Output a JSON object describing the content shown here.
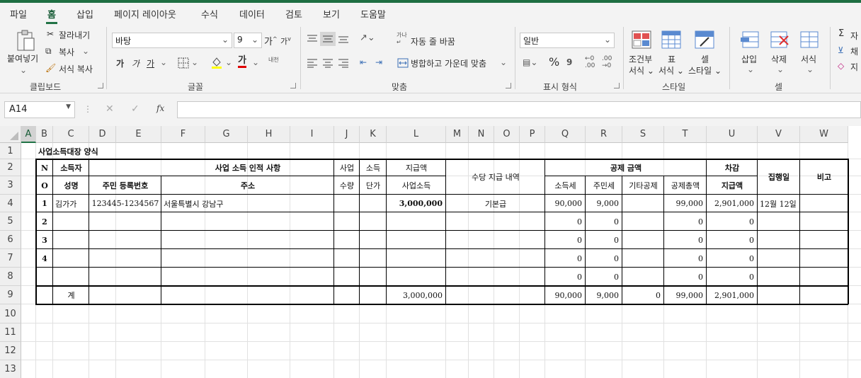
{
  "menu": [
    "파일",
    "홈",
    "삽입",
    "페이지 레이아웃",
    "수식",
    "데이터",
    "검토",
    "보기",
    "도움말"
  ],
  "clipboard": {
    "paste": "붙여넣기",
    "cut": "잘라내기",
    "copy": "복사",
    "format_painter": "서식 복사",
    "label": "클립보드"
  },
  "font": {
    "name": "바탕",
    "size": "9",
    "grow": "가",
    "shrink": "가",
    "bold": "가",
    "italic": "가",
    "underline": "가",
    "font_color": "가",
    "phonetic": "내천",
    "label": "글꼴"
  },
  "alignment": {
    "wrap": "자동 줄 바꿈",
    "merge": "병합하고 가운데 맞춤",
    "label": "맞춤"
  },
  "number": {
    "format": "일반",
    "percent": "%",
    "label": "표시 형식"
  },
  "styles": {
    "conditional_1": "조건부",
    "conditional_2": "서식",
    "table_1": "표",
    "table_2": "서식",
    "cell_1": "셀",
    "cell_2": "스타일",
    "label": "스타일"
  },
  "cells": {
    "insert": "삽입",
    "delete": "삭제",
    "format": "서식",
    "label": "셀"
  },
  "editing": {
    "sum": "자",
    "fill": "채",
    "clear": "지"
  },
  "formula_bar": {
    "name_box": "A14",
    "formula": "",
    "fx": "fx"
  },
  "columns": [
    "A",
    "B",
    "C",
    "D",
    "E",
    "F",
    "G",
    "H",
    "I",
    "J",
    "K",
    "L",
    "M",
    "N",
    "O",
    "P",
    "Q",
    "R",
    "S",
    "T",
    "U",
    "V",
    "W"
  ],
  "rows": [
    "1",
    "2",
    "3",
    "4",
    "5",
    "6",
    "7",
    "8",
    "9",
    "10",
    "11",
    "12",
    "13"
  ],
  "sheet": {
    "title": "사업소득대장 양식",
    "h_no_1": "N",
    "h_no_2": "O",
    "h_earner": "소득자",
    "h_name": "성명",
    "h_id": "주민  등록번호",
    "h_personal": "사업    소득    인적    사항",
    "h_address": "주소",
    "h_biz": "사업",
    "h_qty": "수량",
    "h_income": "소득",
    "h_unit": "단가",
    "h_pay": "지급액",
    "h_bizincome": "사업소득",
    "h_allowance": "수당 지급 내역",
    "h_deduct": "공제     금액",
    "h_incometax": "소득세",
    "h_residenttax": "주민세",
    "h_other": "기타공제",
    "h_total_deduct": "공제총액",
    "h_net_1": "차감",
    "h_net_2": "지급액",
    "h_date": "집행일",
    "h_note": "비고",
    "r4": {
      "no": "1",
      "name": "김가가",
      "id": "123445-1234567",
      "address": "서울특별시 강남구",
      "pay": "3,000,000",
      "allowance": "기본급",
      "incometax": "90,000",
      "residenttax": "9,000",
      "total": "99,000",
      "net": "2,901,000",
      "date": "12월 12일"
    },
    "r5": {
      "no": "2",
      "incometax": "0",
      "residenttax": "0",
      "total": "0",
      "net": "0"
    },
    "r6": {
      "no": "3",
      "incometax": "0",
      "residenttax": "0",
      "total": "0",
      "net": "0"
    },
    "r7": {
      "no": "4",
      "incometax": "0",
      "residenttax": "0",
      "total": "0",
      "net": "0"
    },
    "r8": {
      "incometax": "0",
      "residenttax": "0",
      "total": "0",
      "net": "0"
    },
    "r9": {
      "label": "계",
      "pay": "3,000,000",
      "incometax": "90,000",
      "residenttax": "9,000",
      "other": "0",
      "total": "99,000",
      "net": "2,901,000"
    }
  },
  "colors": {
    "accent": "#217346",
    "ribbon": "#f3f3f3",
    "selected_col": "#d2d2d2"
  }
}
